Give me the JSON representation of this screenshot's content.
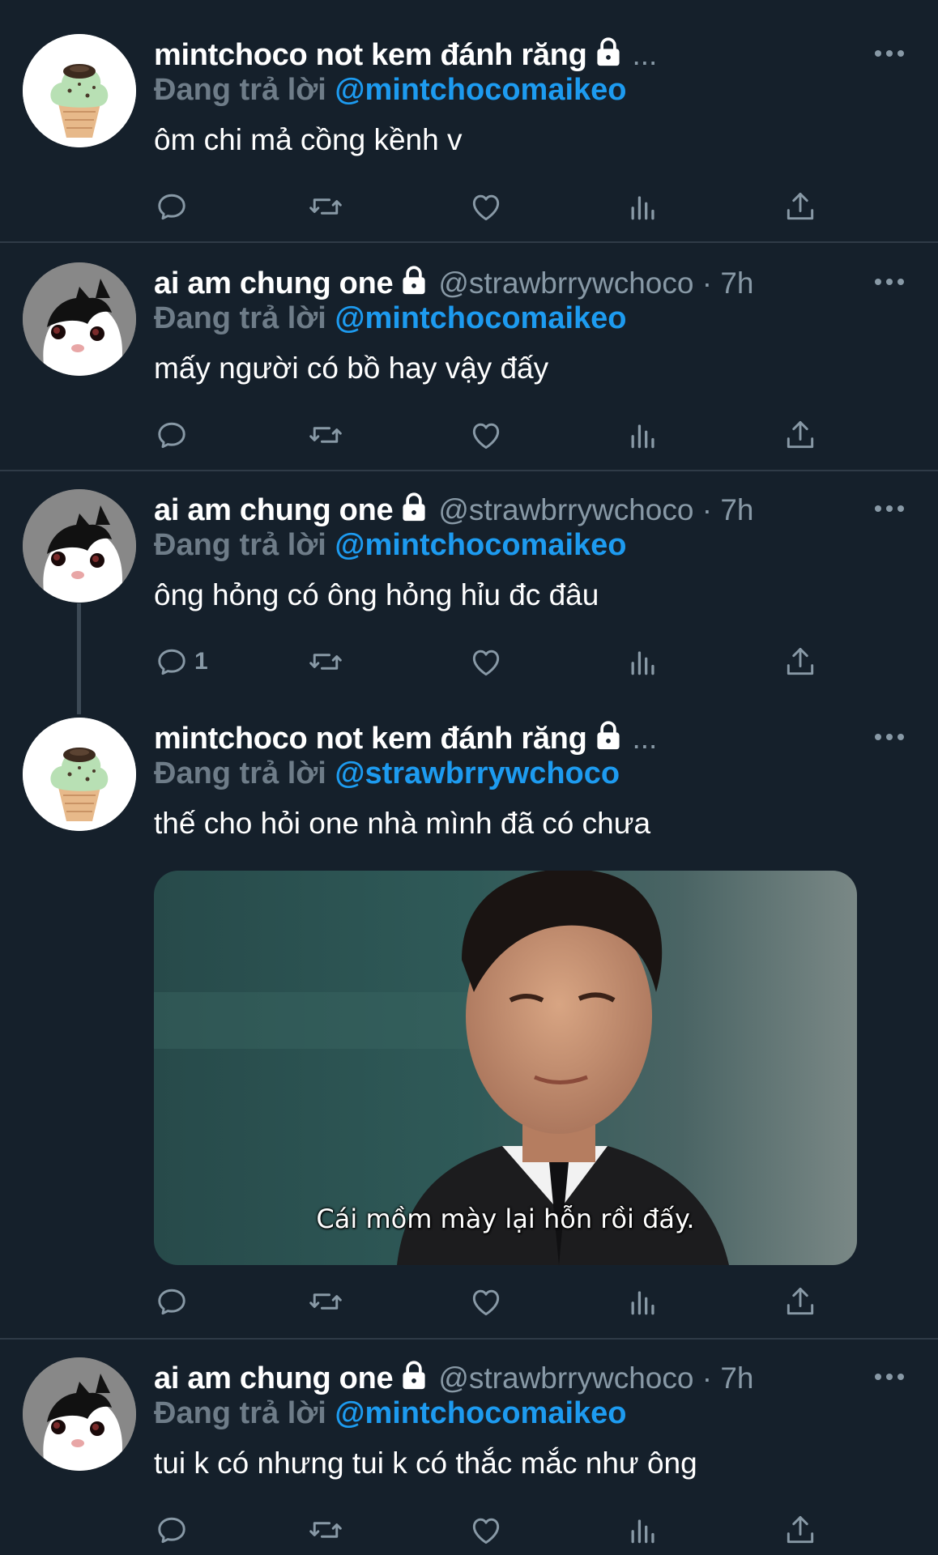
{
  "colors": {
    "background": "#15202b",
    "mention": "#1d9bf0",
    "secondary": "#8899a6",
    "divider": "#2f3b47"
  },
  "tweets": [
    {
      "display_name": "mintchoco not kem đánh răng",
      "handle_meta": "...",
      "reply_label": "Đang trả lời",
      "reply_to": "@mintchocomaikeo",
      "text": "ôm chi mả cồng kềnh v",
      "reply_count": ""
    },
    {
      "display_name": "ai am chung one",
      "handle_meta": "@strawbrrywchoco · 7h",
      "reply_label": "Đang trả lời",
      "reply_to": "@mintchocomaikeo",
      "text": "mấy người có bồ hay vậy đấy",
      "reply_count": ""
    },
    {
      "display_name": "ai am chung one",
      "handle_meta": "@strawbrrywchoco · 7h",
      "reply_label": "Đang trả lời",
      "reply_to": "@mintchocomaikeo",
      "text": "ông hỏng có ông hỏng hỉu đc đâu",
      "reply_count": "1"
    },
    {
      "display_name": "mintchoco not kem đánh răng",
      "handle_meta": "...",
      "reply_label": "Đang trả lời",
      "reply_to": "@strawbrrywchoco",
      "text": "thế cho hỏi one nhà mình đã có chưa",
      "reply_count": "",
      "media_caption": "Cái mồm mày lại hỗn rồi đấy."
    },
    {
      "display_name": "ai am chung one",
      "handle_meta": "@strawbrrywchoco · 7h",
      "reply_label": "Đang trả lời",
      "reply_to": "@mintchocomaikeo",
      "text": "tui k có nhưng tui k có thắc mắc như ông",
      "reply_count": ""
    }
  ],
  "icons": [
    "reply-icon",
    "retweet-icon",
    "like-icon",
    "views-icon",
    "share-icon",
    "lock-icon",
    "more-icon"
  ]
}
